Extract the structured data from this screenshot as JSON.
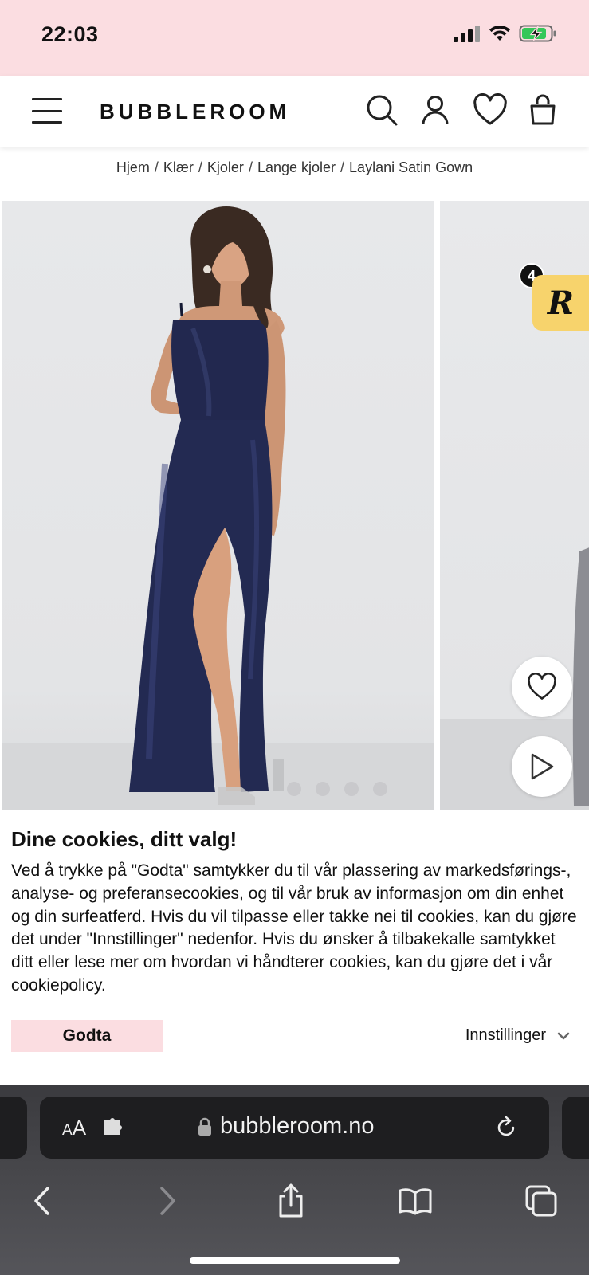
{
  "status_bar": {
    "time": "22:03",
    "icons": [
      "cellular-signal-icon",
      "wifi-icon",
      "battery-charging-icon"
    ]
  },
  "header": {
    "brand": "BUBBLEROOM",
    "icons": [
      "menu-icon",
      "search-icon",
      "account-icon",
      "heart-icon",
      "shopping-bag-icon"
    ]
  },
  "breadcrumb": {
    "items": [
      "Hjem",
      "Klær",
      "Kjoler",
      "Lange kjoler",
      "Laylani Satin Gown"
    ],
    "separator": "/"
  },
  "gallery": {
    "image_count": 5,
    "badge_count": "4",
    "badge_letter": "R",
    "badge_color": "#f7d36c",
    "icons": [
      "heart-icon",
      "play-icon"
    ]
  },
  "cookie_banner": {
    "title": "Dine cookies, ditt valg!",
    "body": "Ved å trykke på \"Godta\" samtykker du til vår plassering av markedsførings-, analyse- og preferansecookies, og til vår bruk av informasjon om din enhet og din surfeatferd. Hvis du vil tilpasse eller takke nei til cookies, kan du gjøre det under \"Innstillinger\" nedenfor. Hvis du ønsker å tilbakekalle samtykket ditt eller lese mer om hvordan vi håndterer cookies, kan du gjøre det i vår cookiepolicy.",
    "accept_label": "Godta",
    "settings_label": "Innstillinger",
    "accent_color": "#fbdde1"
  },
  "browser": {
    "text_size_label_small": "A",
    "text_size_label_large": "A",
    "url": "bubbleroom.no",
    "icons": [
      "extension-icon",
      "lock-icon",
      "reload-icon",
      "back-icon",
      "forward-icon",
      "share-icon",
      "bookmarks-icon",
      "tabs-icon"
    ]
  }
}
